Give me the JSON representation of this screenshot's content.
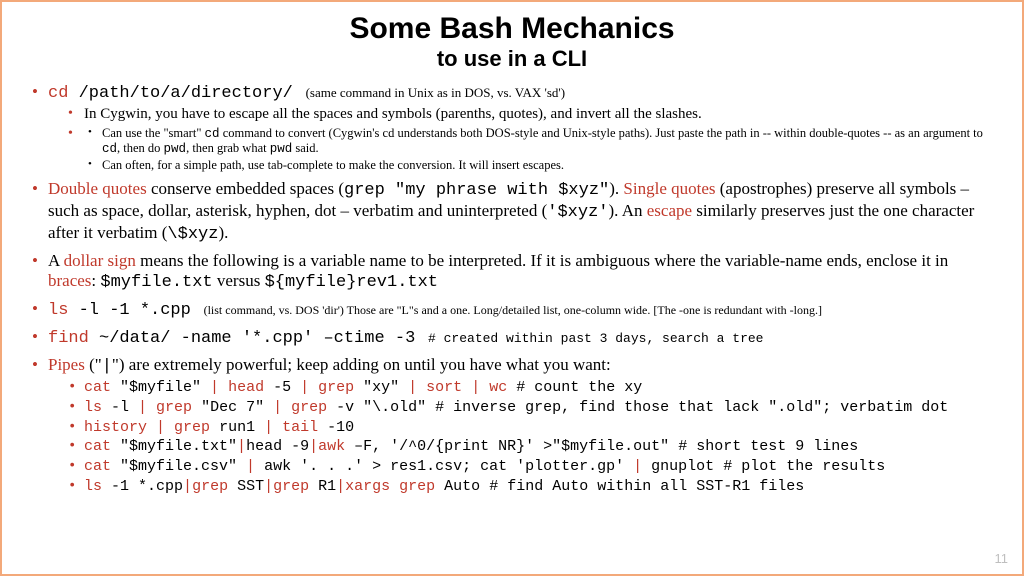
{
  "title": "Some Bash Mechanics",
  "subtitle": "to use in a CLI",
  "b1": {
    "cmd": "cd",
    "path": " /path/to/a/directory/",
    "note": "(same command in Unix as in DOS, vs. VAX 'sd')",
    "sub1": "In Cygwin, you have to escape all the spaces and symbols (parenths, quotes), and invert all the slashes.",
    "subA_a": "Can use the \"smart\" ",
    "subA_cd1": "cd",
    "subA_b": " command to convert (Cygwin's cd understands both DOS-style and Unix-style paths).  Just paste the path in -- within double-quotes -- as an argument to ",
    "subA_cd2": "cd",
    "subA_c": ", then do ",
    "subA_pwd1": "pwd",
    "subA_d": ", then grab what ",
    "subA_pwd2": "pwd",
    "subA_e": " said.",
    "subB": "Can often, for a simple path, use tab-complete to make the conversion.  It will insert escapes."
  },
  "b2": {
    "dq": "Double quotes",
    "a": " conserve embedded spaces (",
    "code1": "grep \"my phrase with $xyz\"",
    "b": ").  ",
    "sq": "Single quotes",
    "c": " (apostrophes) preserve all symbols – such as space, dollar, asterisk, hyphen, dot – verbatim and uninterpreted (",
    "code2": "'$xyz'",
    "d": ").  An ",
    "esc": "escape",
    "e": " similarly preserves just the one character after it verbatim (",
    "code3": "\\$xyz",
    "f": ")."
  },
  "b3": {
    "a": "A ",
    "ds": "dollar sign",
    "b": " means the following is a variable name to be interpreted.  If it is ambiguous where the variable-name ends, enclose it in ",
    "br": "braces",
    "c": ": ",
    "code1": "$myfile.txt",
    "d": "  versus  ",
    "code2": "${myfile}rev1.txt"
  },
  "b4": {
    "cmd": "ls",
    "args": " -l -1 *.cpp",
    "note": "(list command, vs. DOS 'dir')   Those are \"L\"s and a one. Long/detailed list, one-column wide.  [The -one is redundant with -long.]"
  },
  "b5": {
    "cmd": "find",
    "args": " ~/data/ -name '*.cpp' –ctime -3",
    "comment": "# created within past 3 days, search a tree"
  },
  "b6": {
    "pipes": "Pipes",
    "a": " (\"",
    "bar": "|",
    "b": "\") are extremely powerful; keep adding on until you have what you want:"
  },
  "p1": {
    "cat": "cat",
    "arg1": " \"$myfile\" ",
    "pipe1": "| ",
    "head": "head",
    "arg2": " -5 ",
    "pipe2": "| ",
    "grep": "grep",
    "arg3": " \"xy\" ",
    "pipe3": "| ",
    "sort": "sort",
    "sp1": " ",
    "pipe4": "| ",
    "wc": "wc",
    "tail": "     # count the xy"
  },
  "p2": {
    "ls": "ls",
    "arg1": " -l ",
    "pipe1": "| ",
    "grep1": "grep",
    "arg2": " \"Dec 7\" ",
    "pipe2": "| ",
    "grep2": "grep",
    "arg3": " -v ",
    "str": "\"\\.old\"",
    "tail": "     # inverse grep, find those that lack \".old\"; verbatim dot"
  },
  "p3": {
    "history": "history",
    "sp": " ",
    "pipe1": "| ",
    "grep": "grep",
    "arg1": " run1 ",
    "pipe2": "| ",
    "tailcmd": "tail",
    "arg2": " -10"
  },
  "p4": {
    "cat": "cat",
    "arg1": " \"$myfile.txt\"",
    "pipe1": "|",
    "head": "head",
    "arg2": " -9",
    "pipe2": "|",
    "awk": "awk",
    "arg3": " –F, '/^0/{print NR}' >\"$myfile.out\"",
    "tail": "   # short test 9 lines"
  },
  "p5": {
    "cat": "cat",
    "arg1": " \"$myfile.csv\" ",
    "pipe": "| ",
    "awk": "awk",
    "arg2": " '. . .' > res1.csv; ",
    "cat2": "cat",
    "arg3": " 'plotter.gp' ",
    "pipe2": "| ",
    "gnu": "gnuplot",
    "tail": "   # plot the results"
  },
  "p6": {
    "ls": "ls",
    "arg1": " -1 ",
    "glob": "*.cpp",
    "pipe1": "|",
    "grep1": "grep",
    "a1": " SST",
    "pipe2": "|",
    "grep2": "grep",
    "a2": " R1",
    "pipe3": "|",
    "xargs": "xargs grep",
    "a3": " Auto",
    "tail": "     # find Auto within all SST-R1 files"
  },
  "pagenum": "11"
}
